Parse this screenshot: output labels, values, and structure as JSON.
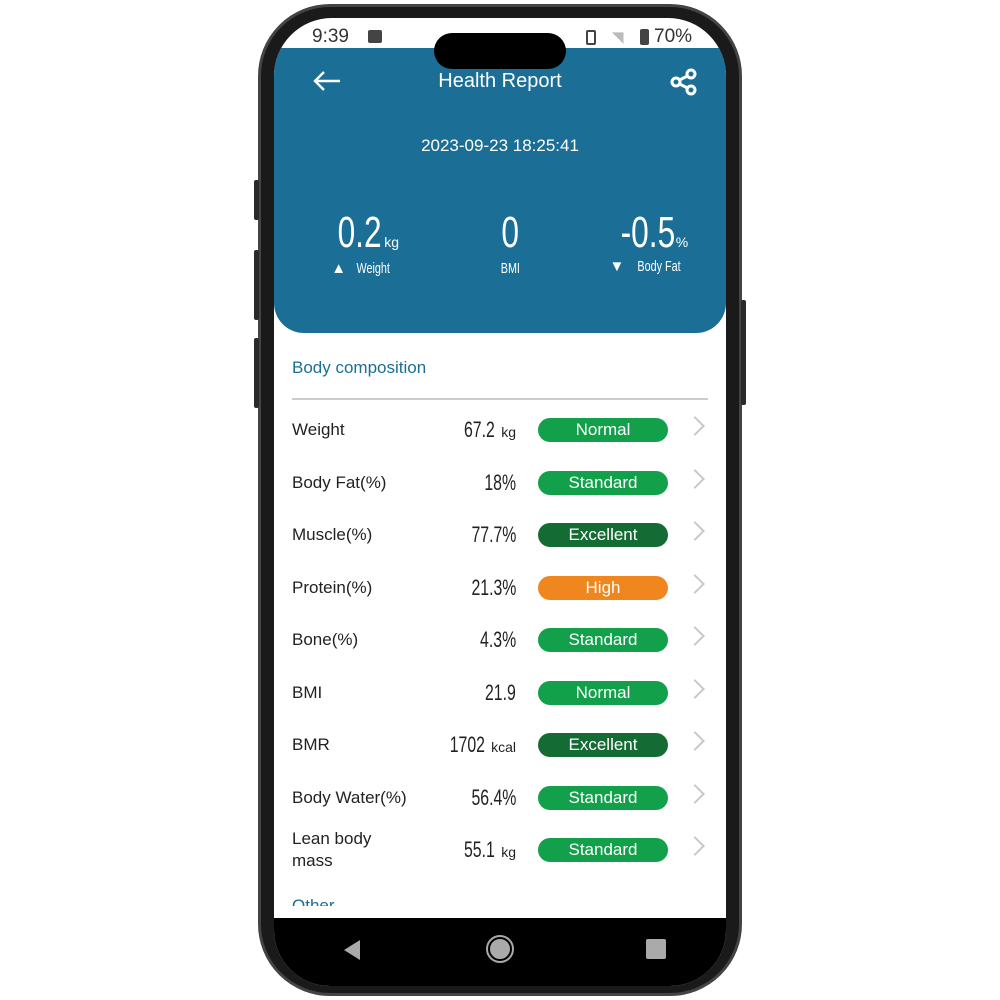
{
  "status": {
    "time": "9:39",
    "battery": "70%"
  },
  "header": {
    "title": "Health Report",
    "datetime": "2023-09-23 18:25:41",
    "stats": [
      {
        "value": "0.2",
        "unit": "kg",
        "label": "Weight",
        "trend": "up"
      },
      {
        "value": "0",
        "unit": "",
        "label": "BMI",
        "trend": ""
      },
      {
        "value": "-0.5",
        "unit": "%",
        "label": "Body Fat",
        "trend": "down"
      }
    ]
  },
  "section": {
    "title": "Body composition",
    "next": "Other"
  },
  "rows": [
    {
      "label": "Weight",
      "value": "67.2",
      "unit": "kg",
      "badge": "Normal",
      "color": "#12a04a"
    },
    {
      "label": "Body Fat(%)",
      "value": "18%",
      "unit": "",
      "badge": "Standard",
      "color": "#12a04a"
    },
    {
      "label": "Muscle(%)",
      "value": "77.7%",
      "unit": "",
      "badge": "Excellent",
      "color": "#156b34"
    },
    {
      "label": "Protein(%)",
      "value": "21.3%",
      "unit": "",
      "badge": "High",
      "color": "#f0861e"
    },
    {
      "label": "Bone(%)",
      "value": "4.3%",
      "unit": "",
      "badge": "Standard",
      "color": "#12a04a"
    },
    {
      "label": "BMI",
      "value": "21.9",
      "unit": "",
      "badge": "Normal",
      "color": "#12a04a"
    },
    {
      "label": "BMR",
      "value": "1702",
      "unit": "kcal",
      "badge": "Excellent",
      "color": "#156b34"
    },
    {
      "label": "Body Water(%)",
      "value": "56.4%",
      "unit": "",
      "badge": "Standard",
      "color": "#12a04a"
    },
    {
      "label": "Lean body mass",
      "value": "55.1",
      "unit": "kg",
      "badge": "Standard",
      "color": "#12a04a"
    }
  ]
}
